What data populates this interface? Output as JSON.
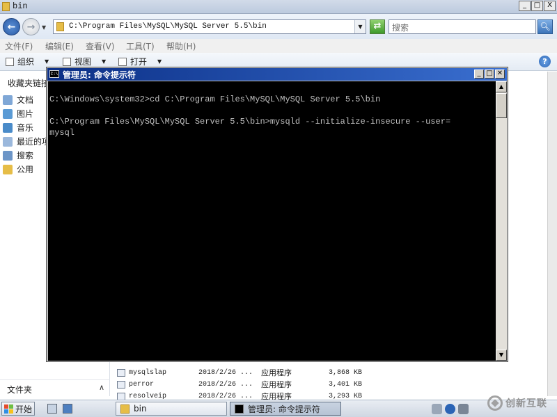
{
  "explorer": {
    "window_title": "bin",
    "window_buttons": [
      "_",
      "□",
      "X"
    ],
    "address": "C:\\Program Files\\MySQL\\MySQL Server 5.5\\bin",
    "search_placeholder": "搜索",
    "menu": [
      "文件(F)",
      "编辑(E)",
      "查看(V)",
      "工具(T)",
      "帮助(H)"
    ],
    "toolbar": {
      "organize": "组织",
      "views": "视图",
      "open": "打开"
    },
    "nav": {
      "favorites_title": "收藏夹链接",
      "items": [
        "文档",
        "图片",
        "音乐",
        "最近的项",
        "搜索",
        "公用"
      ],
      "folders_label": "文件夹"
    },
    "files": [
      {
        "name": "mysqlslap",
        "date": "2018/2/26 ...",
        "type": "应用程序",
        "size": "3,868 KB"
      },
      {
        "name": "perror",
        "date": "2018/2/26 ...",
        "type": "应用程序",
        "size": "3,401 KB"
      },
      {
        "name": "resolveip",
        "date": "2018/2/26 ...",
        "type": "应用程序",
        "size": "3,293 KB"
      }
    ]
  },
  "cmd": {
    "title": "管理员: 命令提示符",
    "icon_text": "C:\\",
    "lines": [
      "C:\\Windows\\system32>cd C:\\Program Files\\MySQL\\MySQL Server 5.5\\bin",
      "",
      "C:\\Program Files\\MySQL\\MySQL Server 5.5\\bin>mysqld --initialize-insecure --user=",
      "mysql"
    ]
  },
  "taskbar": {
    "start_label": "开始",
    "tasks": [
      {
        "label": "bin"
      },
      {
        "label": "管理员: 命令提示符"
      }
    ]
  },
  "watermark": {
    "text": "创新互联"
  },
  "colors": {
    "cmd_title_gradient_start": "#0b2f86",
    "cmd_title_gradient_end": "#3a6fd0",
    "console_bg": "#000000",
    "console_text": "#c0c0c0",
    "folder_yellow": "#e6bd47"
  }
}
